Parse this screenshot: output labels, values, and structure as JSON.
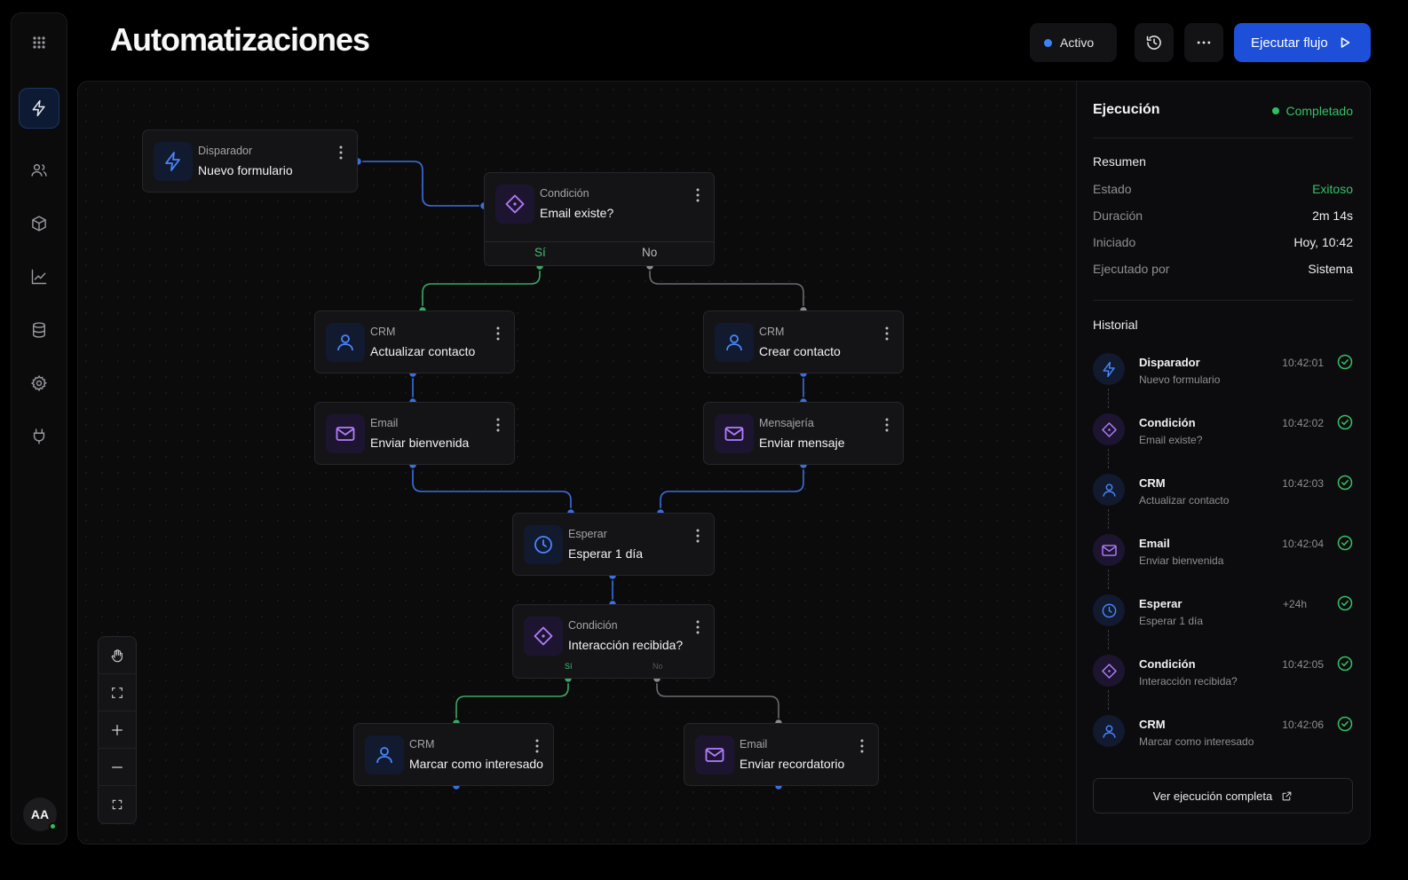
{
  "app": {
    "title": "Automatizaciones",
    "accent": "#1d4fd8",
    "success": "#2fbf5e",
    "avatar_initials": "AA"
  },
  "header": {
    "status_label": "Activo",
    "history_icon": "history-icon",
    "more_icon": "more-horizontal-icon",
    "run_label": "Ejecutar flujo"
  },
  "sidebar": {
    "items": [
      {
        "icon": "grid-icon"
      },
      {
        "icon": "zap-icon",
        "active": true
      },
      {
        "icon": "users-icon"
      },
      {
        "icon": "box-icon"
      },
      {
        "icon": "chart-icon"
      },
      {
        "icon": "database-icon"
      },
      {
        "icon": "settings-icon"
      },
      {
        "icon": "plug-icon"
      }
    ]
  },
  "nodes": {
    "trigger": {
      "category": "Disparador",
      "title": "Nuevo formulario"
    },
    "cond1": {
      "category": "Condición",
      "title": "Email existe?",
      "yes": "Sí",
      "no": "No"
    },
    "crm_update": {
      "category": "CRM",
      "title": "Actualizar contacto"
    },
    "crm_create": {
      "category": "CRM",
      "title": "Crear contacto"
    },
    "email_welcome": {
      "category": "Email",
      "title": "Enviar bienvenida"
    },
    "msg_send": {
      "category": "Mensajería",
      "title": "Enviar mensaje"
    },
    "wait": {
      "category": "Esperar",
      "title": "Esperar 1 día"
    },
    "cond2": {
      "category": "Condición",
      "title": "Interacción recibida?",
      "yes": "Sí",
      "no": "No"
    },
    "crm_mark": {
      "category": "CRM",
      "title": "Marcar como interesado"
    },
    "email_reminder": {
      "category": "Email",
      "title": "Enviar recordatorio"
    }
  },
  "panel": {
    "title": "Ejecución",
    "status": "Completado",
    "summary_title": "Resumen",
    "summary": [
      {
        "key": "Estado",
        "value": "Exitoso"
      },
      {
        "key": "Duración",
        "value": "2m 14s"
      },
      {
        "key": "Iniciado",
        "value": "Hoy, 10:42"
      },
      {
        "key": "Ejecutado por",
        "value": "Sistema"
      }
    ],
    "history_title": "Historial",
    "history": [
      {
        "name": "Disparador",
        "sub": "Nuevo formulario",
        "time": "10:42:01"
      },
      {
        "name": "Condición",
        "sub": "Email existe?",
        "time": "10:42:02"
      },
      {
        "name": "CRM",
        "sub": "Actualizar contacto",
        "time": "10:42:03"
      },
      {
        "name": "Email",
        "sub": "Enviar bienvenida",
        "time": "10:42:04"
      },
      {
        "name": "Esperar",
        "sub": "Esperar 1 día",
        "time": "+24h"
      },
      {
        "name": "Condición",
        "sub": "Interacción recibida?",
        "time": "10:42:05"
      },
      {
        "name": "CRM",
        "sub": "Marcar como interesado",
        "time": "10:42:06"
      }
    ],
    "full_run_label": "Ver ejecución completa"
  }
}
